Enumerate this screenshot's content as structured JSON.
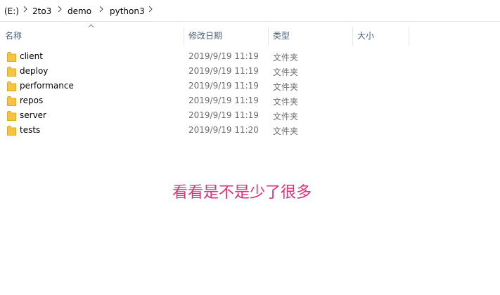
{
  "breadcrumb": {
    "drive": "(E:)",
    "items": [
      "2to3",
      "demo",
      "python3"
    ]
  },
  "columns": {
    "name": "名称",
    "date": "修改日期",
    "type": "类型",
    "size": "大小"
  },
  "files": [
    {
      "name": "client",
      "date": "2019/9/19 11:19",
      "type": "文件夹",
      "size": ""
    },
    {
      "name": "deploy",
      "date": "2019/9/19 11:19",
      "type": "文件夹",
      "size": ""
    },
    {
      "name": "performance",
      "date": "2019/9/19 11:19",
      "type": "文件夹",
      "size": ""
    },
    {
      "name": "repos",
      "date": "2019/9/19 11:19",
      "type": "文件夹",
      "size": ""
    },
    {
      "name": "server",
      "date": "2019/9/19 11:19",
      "type": "文件夹",
      "size": ""
    },
    {
      "name": "tests",
      "date": "2019/9/19 11:20",
      "type": "文件夹",
      "size": ""
    }
  ],
  "annotation": "看看是不是少了很多",
  "colors": {
    "folder": "#f5c542",
    "folder_dark": "#dfa92c",
    "header_text": "#4c607a",
    "annotation": "#e0307a"
  },
  "icons": {
    "folder": "folder-icon",
    "separator": "chevron-right-icon",
    "sort": "sort-ascending-icon"
  }
}
